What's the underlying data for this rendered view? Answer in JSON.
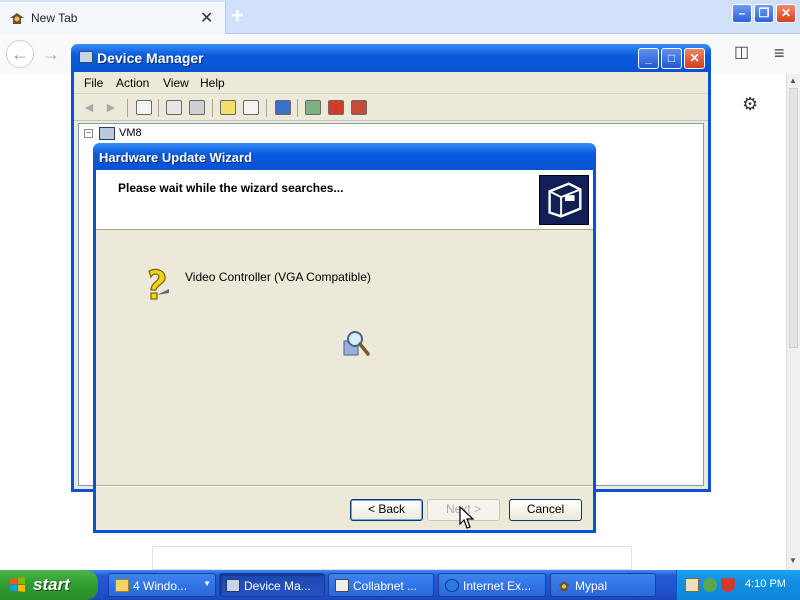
{
  "browser": {
    "tab_title": "New Tab",
    "tab_close": "✕",
    "new_tab": "+",
    "back": "←",
    "forward": "→",
    "win_min": "–",
    "win_max": "❐",
    "win_close": "✕",
    "sidebar_glyph": "◫",
    "menu_glyph": "≡",
    "gear_glyph": "⚙"
  },
  "device_manager": {
    "title": "Device Manager",
    "menu": [
      "File",
      "Action",
      "View",
      "Help"
    ],
    "tree_root": "VM8",
    "tree_expander": "−",
    "btn_min": "_",
    "btn_max": "□",
    "btn_close": "✕"
  },
  "wizard": {
    "title": "Hardware Update Wizard",
    "heading": "Please wait while the wizard searches...",
    "device": "Video Controller (VGA Compatible)",
    "back_label": "< Back",
    "next_label": "Next >",
    "cancel_label": "Cancel"
  },
  "taskbar": {
    "start_label": "start",
    "items": [
      {
        "label": "4 Windo...",
        "active": false
      },
      {
        "label": "Device Ma...",
        "active": true
      },
      {
        "label": "Collabnet ...",
        "active": false
      },
      {
        "label": "Internet Ex...",
        "active": false
      },
      {
        "label": "Mypal",
        "active": false
      }
    ],
    "dropdown_glyph": "▼",
    "clock": "4:10 PM"
  },
  "colors": {
    "xp_title_blue": "#0a5bdf",
    "start_green": "#32a032",
    "taskbar_blue": "#2459d6",
    "tray_blue": "#1290e3",
    "window_face": "#ece9d8"
  }
}
